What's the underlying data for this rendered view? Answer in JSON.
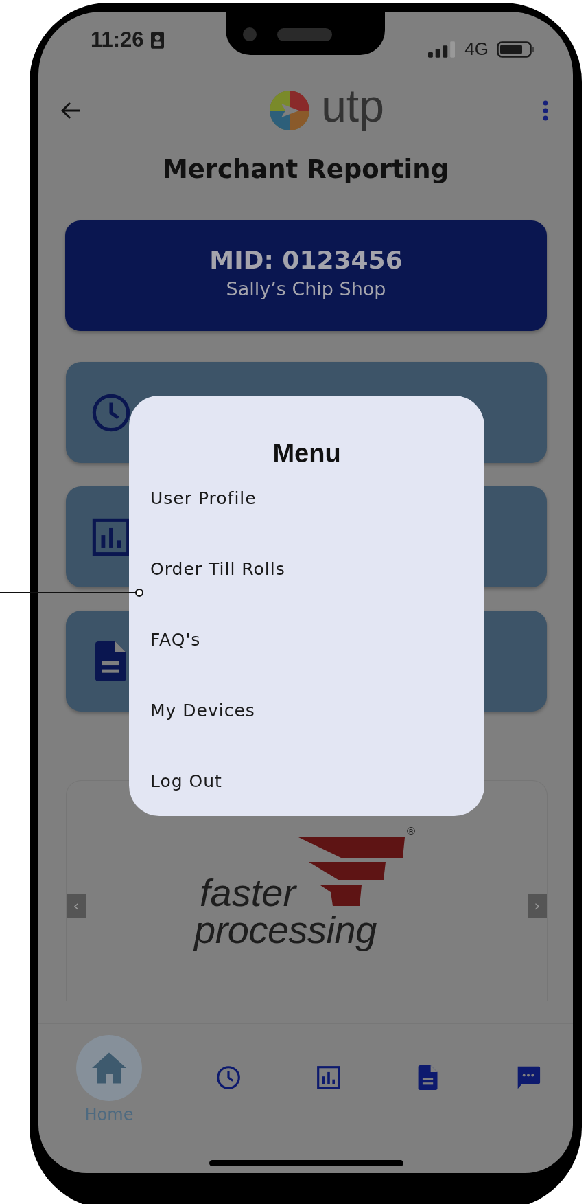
{
  "status_bar": {
    "time": "11:26",
    "network": "4G"
  },
  "header": {
    "logo_text": "utp",
    "title": "Merchant Reporting"
  },
  "merchant": {
    "mid": "MID: 0123456",
    "name": "Sally’s Chip Shop"
  },
  "cards": [
    {
      "kind": "clock"
    },
    {
      "kind": "chart"
    },
    {
      "kind": "document"
    }
  ],
  "menu": {
    "title": "Menu",
    "items": [
      "User Profile",
      "Order Till Rolls",
      "FAQ's",
      "My Devices",
      "Log Out"
    ]
  },
  "banner": {
    "line_1": "faster",
    "line_2": "processing",
    "registered_mark": "®",
    "prev": "‹",
    "next": "›"
  },
  "nav": [
    {
      "kind": "home",
      "label": "Home",
      "selected": true
    },
    {
      "kind": "clock",
      "selected": false
    },
    {
      "kind": "chart",
      "selected": false
    },
    {
      "kind": "document",
      "selected": false
    },
    {
      "kind": "chat",
      "selected": false
    }
  ]
}
